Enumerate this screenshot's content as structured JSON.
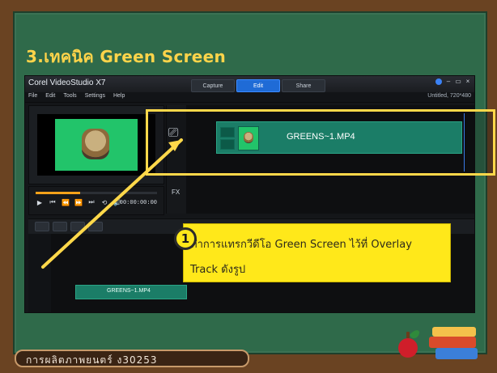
{
  "slide": {
    "title": "3.เทคนิค Green Screen",
    "footer_label": "การผลิตภาพยนตร์ ง30253"
  },
  "app": {
    "window_title": "Corel VideoStudio X7",
    "tabs": [
      {
        "label": "Capture",
        "active": false
      },
      {
        "label": "Edit",
        "active": true
      },
      {
        "label": "Share",
        "active": false
      }
    ],
    "menu": [
      "File",
      "Edit",
      "Tools",
      "Settings",
      "Help"
    ],
    "project_info": "Untitled, 720*480",
    "fx_label": "FX",
    "preview_timecode": "00:00:00:00",
    "window_controls": [
      "‒",
      "▭",
      "×"
    ],
    "player_controls": [
      "play-icon",
      "start-icon",
      "prev-icon",
      "next-icon",
      "end-icon",
      "loop-icon",
      "volume-icon"
    ]
  },
  "track": {
    "clip_name": "GREENS~1.MP4",
    "timeline_clip_name": "GREENS~1.MP4",
    "icons": [
      "overlay-track-icon",
      "video-track-icon"
    ]
  },
  "callout": {
    "step_number": "1",
    "text": "ทำการแทรกวีดีโอ Green Screen ไว้ที่ Overlay Track ดังรูป"
  },
  "colors": {
    "highlight": "#ffd84a",
    "callout_bg": "#ffe81a",
    "board": "#2f6a4a",
    "title_yellow": "#ffd44a",
    "tab_active": "#1f6bd6",
    "clip_green": "#1b7d67"
  }
}
